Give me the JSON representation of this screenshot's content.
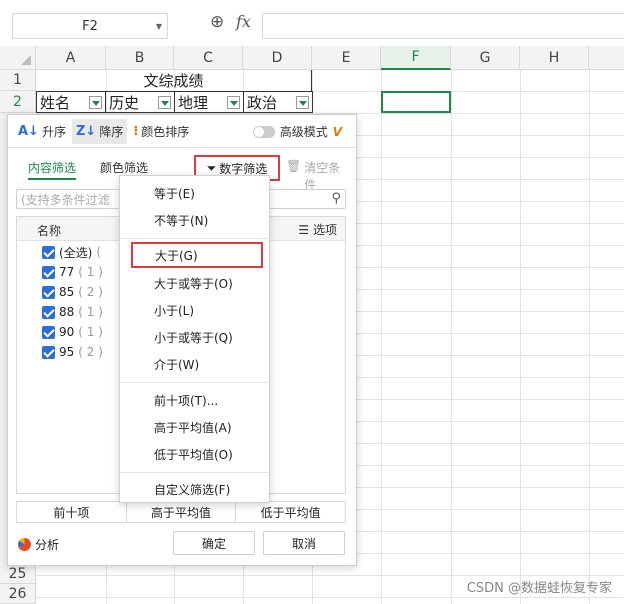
{
  "formula_bar": {
    "name_box": "F2",
    "zoom_icon": "zoom-icon",
    "fx_label": "fx",
    "formula": ""
  },
  "columns": [
    "A",
    "B",
    "C",
    "D",
    "E",
    "F",
    "G",
    "H"
  ],
  "active_column": "F",
  "rows": [
    "1",
    "2",
    "25",
    "26"
  ],
  "sheet": {
    "title": "文综成绩",
    "headers": [
      "姓名",
      "历史",
      "地理",
      "政治"
    ]
  },
  "filter_panel": {
    "sort": {
      "asc": "升序",
      "desc": "降序",
      "color": "颜色排序"
    },
    "advanced_mode": "高级模式",
    "tabs": {
      "content": "内容筛选",
      "color": "颜色筛选",
      "number": "数字筛选",
      "clear": "清空条件"
    },
    "search_placeholder": "(支持多条件过滤",
    "list_header": {
      "name": "名称",
      "options": "选项"
    },
    "items": [
      {
        "label": "(全选)",
        "count": "("
      },
      {
        "label": "77",
        "count": "( 1 )"
      },
      {
        "label": "85",
        "count": "( 2 )"
      },
      {
        "label": "88",
        "count": "( 1 )"
      },
      {
        "label": "90",
        "count": "( 1 )"
      },
      {
        "label": "95",
        "count": "( 2 )"
      }
    ],
    "quick": [
      "前十项",
      "高于平均值",
      "低于平均值"
    ],
    "analyze": "分析",
    "ok": "确定",
    "cancel": "取消"
  },
  "number_menu": {
    "items": [
      "等于(E)",
      "不等于(N)",
      "大于(G)",
      "大于或等于(O)",
      "小于(L)",
      "小于或等于(Q)",
      "介于(W)",
      "前十项(T)...",
      "高于平均值(A)",
      "低于平均值(O)",
      "自定义筛选(F)"
    ],
    "highlighted": "大于(G)"
  },
  "watermark": "CSDN @数据蛙恢复专家"
}
